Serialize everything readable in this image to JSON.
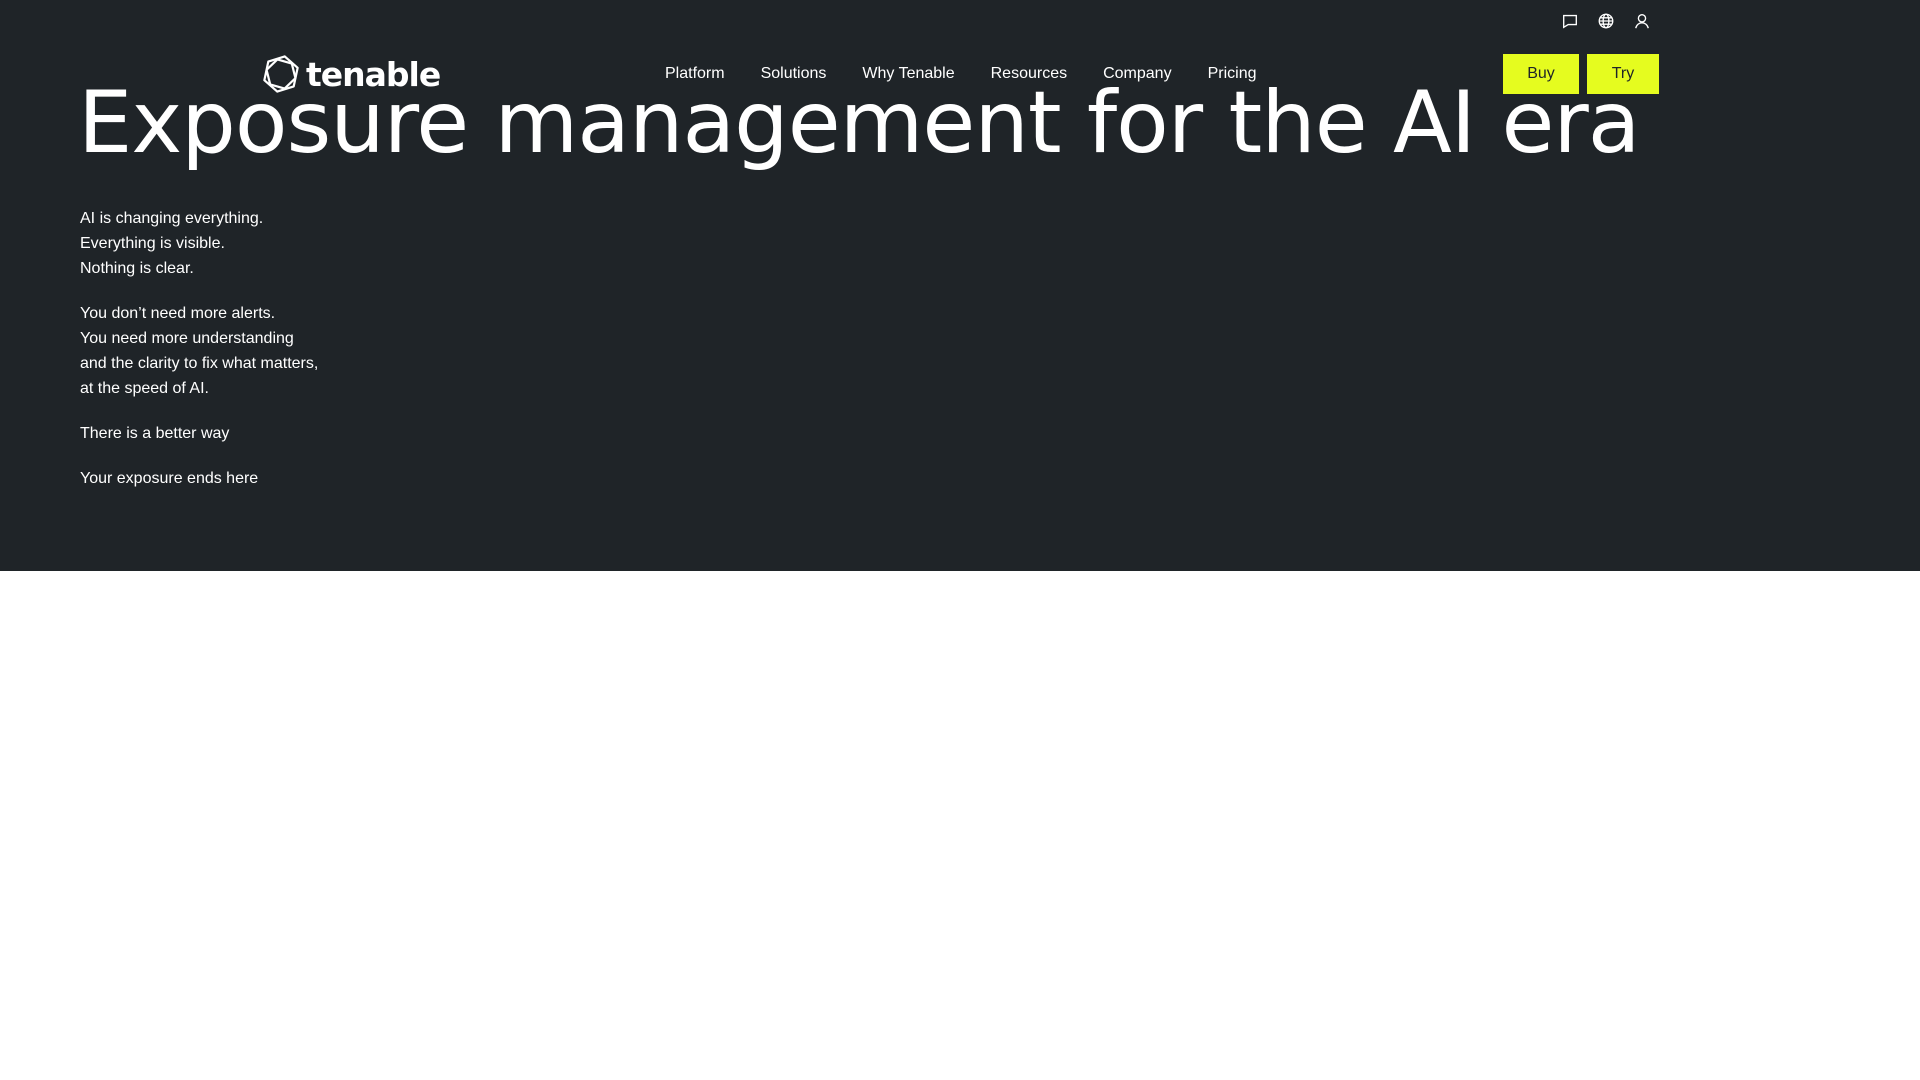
{
  "utility": {
    "icons": [
      "chat-icon",
      "globe-icon",
      "user-icon"
    ]
  },
  "nav": {
    "logo_text": "tenable",
    "items": [
      "Platform",
      "Solutions",
      "Why Tenable",
      "Resources",
      "Company",
      "Pricing"
    ],
    "buy_label": "Buy",
    "try_label": "Try"
  },
  "hero": {
    "headline": "Exposure management for the AI era",
    "paragraphs": [
      [
        "AI is changing everything.",
        "Everything is visible.",
        "Nothing is clear."
      ],
      [
        "You don’t need more alerts.",
        "You need more understanding",
        "and the clarity to fix what matters,",
        "at the speed of AI."
      ],
      [
        "There is a better way"
      ],
      [
        "Your exposure ends here"
      ]
    ]
  },
  "colors": {
    "hero_background": "#1f2428",
    "accent": "#e5fc1f",
    "text": "#ffffff",
    "page_background": "#ffffff"
  }
}
